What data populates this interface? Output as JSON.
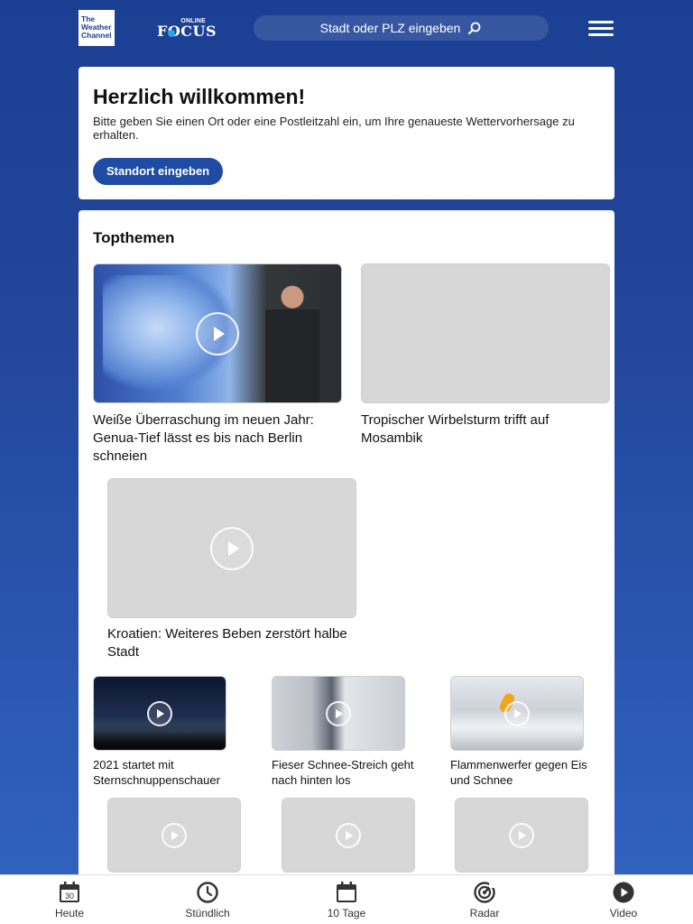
{
  "header": {
    "twc_logo": [
      "The",
      "Weather",
      "Channel"
    ],
    "focus_online": "ONLINE",
    "focus_word": "FOCUS",
    "search_placeholder": "Stadt oder PLZ eingeben"
  },
  "welcome": {
    "title": "Herzlich willkommen!",
    "text": "Bitte geben Sie einen Ort oder eine Postleitzahl ein, um Ihre genaueste Wettervorhersage zu erhalten.",
    "button": "Standort eingeben"
  },
  "topthemen": {
    "heading": "Topthemen",
    "big": [
      {
        "title": "Weiße Überraschung im neuen Jahr: Genua-Tief lässt es bis nach Berlin schneien"
      },
      {
        "title": "Tropischer Wirbelsturm trifft auf Mosambik"
      },
      {
        "title": "Kroatien: Weiteres Beben zerstört halbe Stadt"
      }
    ],
    "small": [
      {
        "title": "2021 startet mit Sternschnuppenschauer"
      },
      {
        "title": "Fieser Schnee-Streich geht nach hinten los"
      },
      {
        "title": "Flammenwerfer gegen Eis und Schnee"
      }
    ]
  },
  "bottom_nav": {
    "items": [
      {
        "label": "Heute",
        "icon": "calendar-30-icon",
        "day": "30"
      },
      {
        "label": "Stündlich",
        "icon": "clock-icon"
      },
      {
        "label": "10 Tage",
        "icon": "calendar-icon"
      },
      {
        "label": "Radar",
        "icon": "radar-icon"
      },
      {
        "label": "Video",
        "icon": "play-circle-icon"
      }
    ]
  },
  "colors": {
    "background_top": "#1b3f93",
    "background_bottom": "#3164c0",
    "accent_button": "#1f4ba3"
  }
}
